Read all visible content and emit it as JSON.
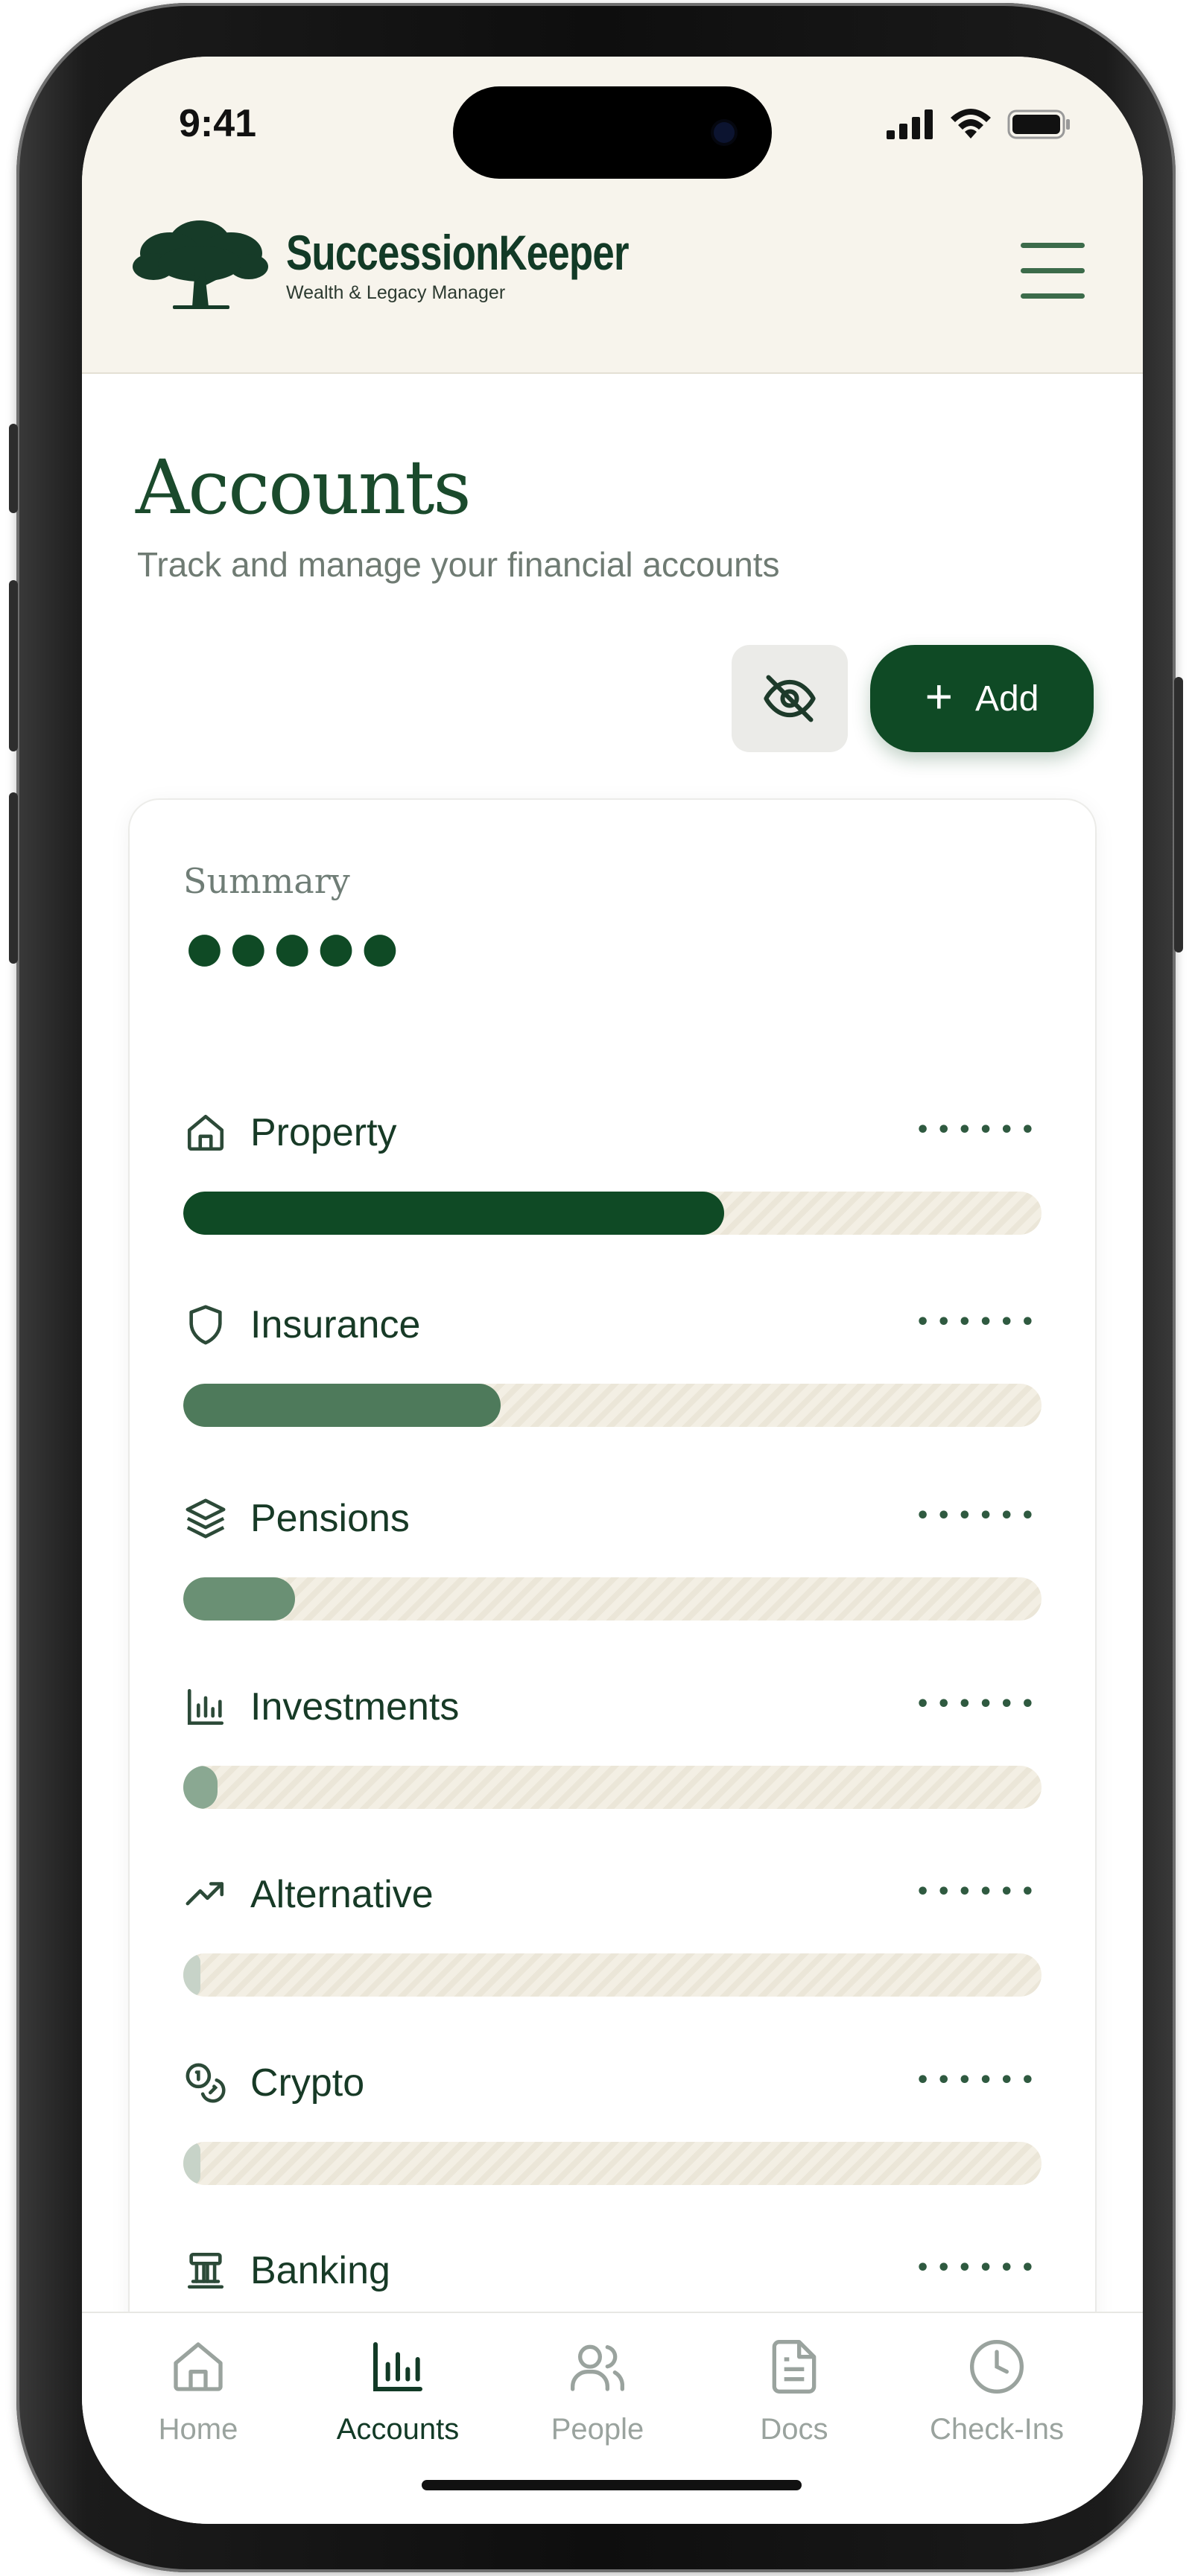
{
  "status": {
    "time": "9:41"
  },
  "brand": {
    "name": "SuccessionKeeper",
    "tagline": "Wealth & Legacy Manager"
  },
  "page": {
    "title": "Accounts",
    "subtitle": "Track and manage your financial accounts"
  },
  "actions": {
    "add_label": "Add",
    "toggle_icon": "eye-off-icon",
    "add_icon": "plus-icon"
  },
  "summary": {
    "label": "Summary",
    "masked_total": "●●●●●",
    "categories": [
      {
        "label": "Property",
        "masked_value": "••••••",
        "share": 0.63,
        "icon": "home-icon",
        "color": "#0f4a25"
      },
      {
        "label": "Insurance",
        "masked_value": "••••••",
        "share": 0.37,
        "icon": "shield-icon",
        "color": "#4e7a5b"
      },
      {
        "label": "Pensions",
        "masked_value": "••••••",
        "share": 0.13,
        "icon": "layers-icon",
        "color": "#6a9074"
      },
      {
        "label": "Investments",
        "masked_value": "••••••",
        "share": 0.04,
        "icon": "bar-chart-icon",
        "color": "#8aa892"
      },
      {
        "label": "Alternative",
        "masked_value": "••••••",
        "share": 0.02,
        "icon": "trending-up-icon",
        "color": "#c7d3c8"
      },
      {
        "label": "Crypto",
        "masked_value": "••••••",
        "share": 0.02,
        "icon": "coins-icon",
        "color": "#c7d3c8"
      },
      {
        "label": "Banking",
        "masked_value": "••••••",
        "share": 0.0,
        "icon": "bank-icon",
        "color": "#c7d3c8"
      }
    ]
  },
  "nav": {
    "active": "Accounts",
    "items": [
      {
        "label": "Home",
        "icon": "home-icon"
      },
      {
        "label": "Accounts",
        "icon": "bar-chart-icon"
      },
      {
        "label": "People",
        "icon": "users-icon"
      },
      {
        "label": "Docs",
        "icon": "document-icon"
      },
      {
        "label": "Check-Ins",
        "icon": "clock-icon"
      }
    ]
  },
  "colors": {
    "brand": "#0f4a25",
    "header_bg": "#f7f4ec"
  }
}
